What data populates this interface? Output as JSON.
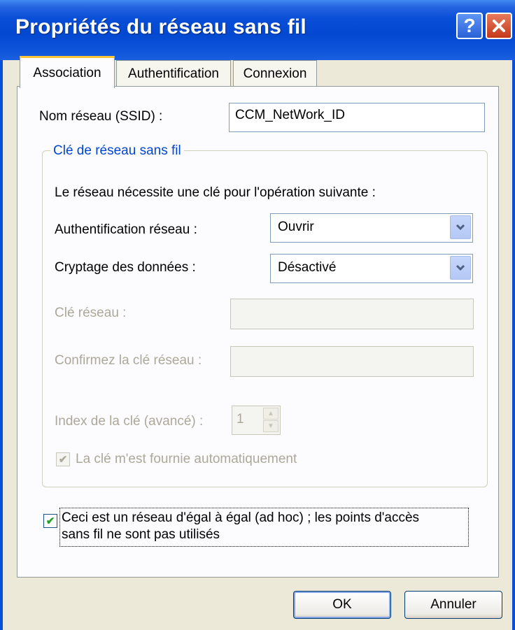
{
  "window": {
    "title": "Propriétés du réseau sans fil",
    "help_glyph": "?",
    "close_glyph": "✕"
  },
  "tabs": [
    {
      "label": "Association",
      "active": true
    },
    {
      "label": "Authentification",
      "active": false
    },
    {
      "label": "Connexion",
      "active": false
    }
  ],
  "association": {
    "ssid_label": "Nom réseau (SSID) :",
    "ssid_value": "CCM_NetWork_ID",
    "group_title": "Clé de réseau sans fil",
    "requirement_text": "Le réseau nécessite une clé pour l'opération suivante :",
    "auth_label": "Authentification réseau :",
    "auth_value": "Ouvrir",
    "encryption_label": "Cryptage des données :",
    "encryption_value": "Désactivé",
    "key_label": "Clé réseau :",
    "key_value": "",
    "confirm_key_label": "Confirmez la clé réseau :",
    "confirm_key_value": "",
    "key_index_label": "Index de la clé (avancé) :",
    "key_index_value": "1",
    "auto_key_label": "La clé m'est fournie automatiquement",
    "auto_key_checked": true,
    "adhoc_label_line1": "Ceci est un réseau d'égal à égal (ad hoc) ; les points d'accès",
    "adhoc_label_line2": "sans fil ne sont pas utilisés",
    "adhoc_checked": true
  },
  "buttons": {
    "ok": "OK",
    "cancel": "Annuler"
  },
  "colors": {
    "titlebar": "#0A4FD8",
    "dialog_bg": "#ECE9D8",
    "group_title": "#0046D5",
    "disabled_text": "#ACA899",
    "check_mark": "#21A121"
  },
  "icons": {
    "checkmark": "✔",
    "dropdown": "chevron-down-icon"
  }
}
